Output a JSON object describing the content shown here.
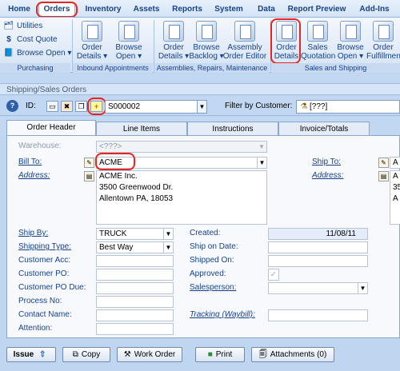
{
  "ribbon": {
    "tabs": [
      "Home",
      "Orders",
      "Inventory",
      "Assets",
      "Reports",
      "System",
      "Data",
      "Report Preview",
      "Add-Ins"
    ],
    "active_tab": "Orders",
    "purchasing": {
      "utilities": "Utilities",
      "cost_quote": "Cost Quote",
      "browse_open": "Browse Open ▾",
      "group_label": "Purchasing"
    },
    "inbound": {
      "order_details_1": "Order",
      "order_details_2": "Details ▾",
      "browse_open_1": "Browse",
      "browse_open_2": "Open ▾",
      "group_label": "Inbound Appointments"
    },
    "assemblies": {
      "order_details_1": "Order",
      "order_details_2": "Details ▾",
      "browse_backlog_1": "Browse",
      "browse_backlog_2": "Backlog ▾",
      "assembly_editor_1": "Assembly",
      "assembly_editor_2": "Order Editor",
      "group_label": "Assemblies, Repairs, Maintenance"
    },
    "sales": {
      "order_details_1": "Order",
      "order_details_2": "Details",
      "sales_quotation_1": "Sales",
      "sales_quotation_2": "Quotation",
      "browse_open_1": "Browse",
      "browse_open_2": "Open ▾",
      "order_fulfillment_1": "Order",
      "order_fulfillment_2": "Fulfillment",
      "group_label": "Sales and Shipping"
    }
  },
  "window": {
    "title": "Shipping/Sales Orders"
  },
  "idbar": {
    "id_label": "ID:",
    "id_value": "S000002",
    "filter_label": "Filter by Customer:",
    "filter_value": "[???]"
  },
  "doc_tabs": [
    "Order Header",
    "Line Items",
    "Instructions",
    "Invoice/Totals"
  ],
  "form": {
    "warehouse_label": "Warehouse:",
    "warehouse_value": "<???>",
    "bill_to_label": "Bill To:",
    "bill_to_value": "ACME",
    "address_label": "Address:",
    "address_lines": [
      "ACME Inc.",
      "3500 Greenwood Dr.",
      "Allentown PA, 18053"
    ],
    "ship_to_label": "Ship To:",
    "ship_to_address_label": "Address:",
    "ship_to_value_fragment": "A",
    "ship_to_address_fragments": [
      "A",
      "35",
      "A"
    ],
    "ship_by_label": "Ship By:",
    "ship_by_value": "TRUCK",
    "shipping_type_label": "Shipping Type:",
    "shipping_type_value": "Best Way",
    "customer_acc_label": "Customer Acc:",
    "customer_po_label": "Customer PO:",
    "customer_po_due_label": "Customer PO Due:",
    "process_no_label": "Process No:",
    "contact_name_label": "Contact Name:",
    "attention_label": "Attention:",
    "created_label": "Created:",
    "created_value": "11/08/11",
    "ship_on_date_label": "Ship on Date:",
    "shipped_on_label": "Shipped On:",
    "approved_label": "Approved:",
    "salesperson_label": "Salesperson:",
    "tracking_label": "Tracking (Waybill):"
  },
  "bottom": {
    "issue": "Issue",
    "copy": "Copy",
    "work_order": "Work Order",
    "print": "Print",
    "attachments": "Attachments (0)"
  }
}
